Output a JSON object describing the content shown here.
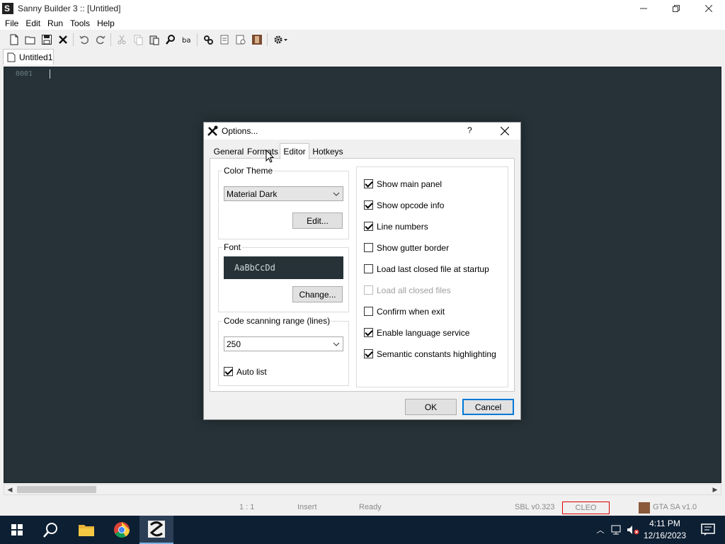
{
  "window": {
    "title": "Sanny Builder 3 :: [Untitled]"
  },
  "menu": {
    "items": [
      "File",
      "Edit",
      "Run",
      "Tools",
      "Help"
    ]
  },
  "toolbar": {
    "icons": [
      "new-file-icon",
      "open-folder-icon",
      "save-icon",
      "close-icon",
      "undo-icon",
      "redo-icon",
      "cut-icon",
      "copy-icon",
      "paste-icon",
      "find-icon",
      "replace-icon",
      "compile-icon",
      "compile-icon-2",
      "script-icon",
      "game-icon",
      "settings-icon"
    ]
  },
  "document": {
    "tab_label": "Untitled1",
    "line_number": "0001"
  },
  "status": {
    "position": "1 :   1",
    "mode": "Insert",
    "state": "Ready",
    "version": "SBL v0.323",
    "cleo": "CLEO",
    "game": "GTA SA v1.0"
  },
  "taskbar": {
    "time": "4:11 PM",
    "date": "12/16/2023"
  },
  "dialog": {
    "title": "Options...",
    "help": "?",
    "tabs": [
      "General",
      "Formats",
      "Editor",
      "Hotkeys"
    ],
    "active_tab": "Editor",
    "color_theme": {
      "label": "Color Theme",
      "value": "Material Dark",
      "edit_label": "Edit..."
    },
    "font": {
      "label": "Font",
      "preview": "AaBbCcDd",
      "change_label": "Change..."
    },
    "scanning": {
      "label": "Code scanning range (lines)",
      "value": "250",
      "auto_list": "Auto list",
      "auto_list_checked": true
    },
    "options": [
      {
        "label": "Show main panel",
        "checked": true,
        "disabled": false
      },
      {
        "label": "Show opcode info",
        "checked": true,
        "disabled": false
      },
      {
        "label": "Line numbers",
        "checked": true,
        "disabled": false
      },
      {
        "label": "Show gutter border",
        "checked": false,
        "disabled": false
      },
      {
        "label": "Load last closed file at startup",
        "checked": false,
        "disabled": false
      },
      {
        "label": "Load all closed files",
        "checked": false,
        "disabled": true
      },
      {
        "label": "Confirm when exit",
        "checked": false,
        "disabled": false
      },
      {
        "label": "Enable language service",
        "checked": true,
        "disabled": false
      },
      {
        "label": "Semantic constants highlighting",
        "checked": true,
        "disabled": false
      }
    ],
    "ok_label": "OK",
    "cancel_label": "Cancel"
  }
}
